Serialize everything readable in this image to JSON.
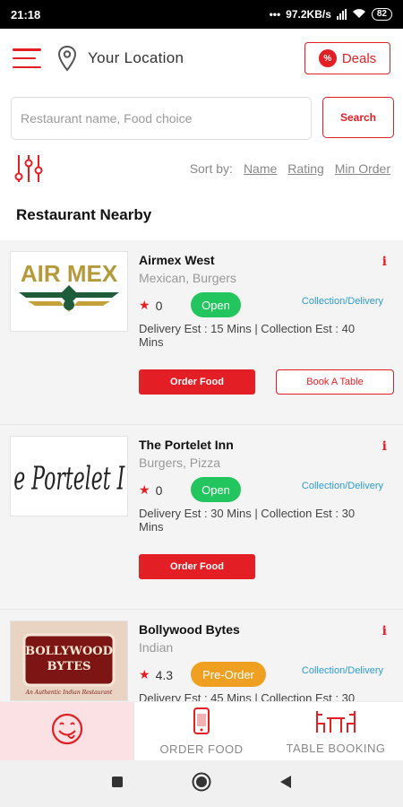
{
  "status_bar": {
    "time": "21:18",
    "net_speed": "97.2KB/s",
    "network": "4G",
    "battery": "82"
  },
  "header": {
    "location_label": "Your Location",
    "deals_label": "Deals",
    "deals_badge": "%"
  },
  "search": {
    "placeholder": "Restaurant name, Food choice",
    "value": "",
    "button_label": "Search"
  },
  "sort": {
    "label": "Sort by:",
    "options": [
      "Name",
      "Rating",
      "Min Order"
    ]
  },
  "section_title": "Restaurant Nearby",
  "restaurants": [
    {
      "name": "Airmex West",
      "cuisine": "Mexican, Burgers",
      "rating": "0",
      "status": "Open",
      "service": "Collection/Delivery",
      "delivery": "Delivery Est : 15 Mins | Collection Est : 40 Mins",
      "order_label": "Order Food",
      "book_label": "Book A Table",
      "logo_text": "AIR MEX"
    },
    {
      "name": "The Portelet Inn",
      "cuisine": "Burgers, Pizza",
      "rating": "0",
      "status": "Open",
      "service": "Collection/Delivery",
      "delivery": "Delivery Est : 30 Mins | Collection Est : 30 Mins",
      "order_label": "Order Food",
      "logo_text": "The Portelet Inn"
    },
    {
      "name": "Bollywood Bytes",
      "cuisine": "Indian",
      "rating": "4.3",
      "status": "Pre-Order",
      "service": "Collection/Delivery",
      "delivery": "Delivery Est : 45 Mins | Collection Est : 30",
      "logo_line1": "BOLLYWOOD",
      "logo_line2": "BYTES",
      "logo_tagline": "An Authentic Indian Restaurant"
    }
  ],
  "bottom_nav": {
    "order_food": "ORDER FOOD",
    "table_booking": "TABLE BOOKING"
  },
  "colors": {
    "brand": "#e31e24",
    "open": "#22c55e",
    "preorder": "#f0a020",
    "service": "#2f9bd1",
    "active_tab_bg": "#fbe1e3"
  }
}
